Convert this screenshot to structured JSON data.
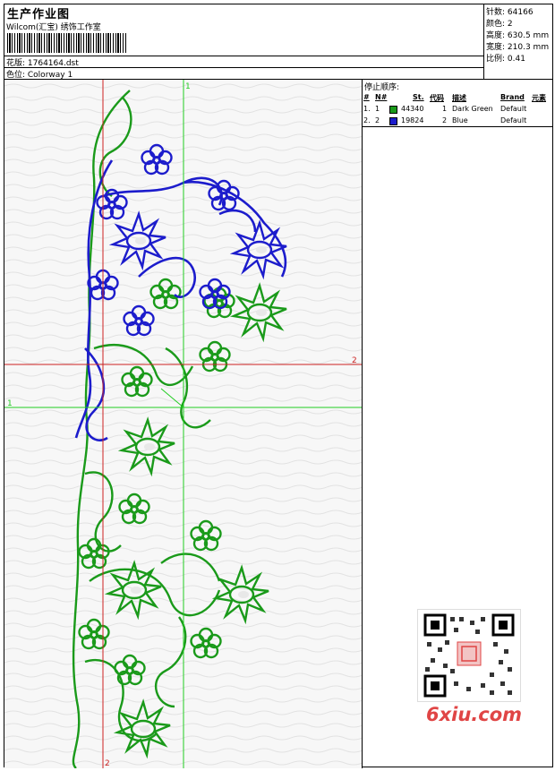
{
  "header": {
    "title": "生产作业图",
    "company": "Wilcom(汇宝) 绣饰工作室",
    "design_file": "花版: 1764164.dst",
    "colorway": "色位: Colorway 1"
  },
  "info": [
    {
      "label": "针数",
      "value": "64166"
    },
    {
      "label": "颜色",
      "value": "2"
    },
    {
      "label": "高度",
      "value": "630.5 mm"
    },
    {
      "label": "宽度",
      "value": "210.3 mm"
    },
    {
      "label": "比例",
      "value": "0.41"
    }
  ],
  "stop_sequence": {
    "title": "停止顺序:",
    "headers": {
      "index": "#",
      "needle": "N#",
      "stitches": "St.",
      "code": "代码",
      "desc": "描述",
      "brand": "Brand",
      "element": "元素"
    },
    "rows": [
      {
        "index": "1.",
        "needle": "1",
        "color": "#1a9a1a",
        "stitches": "44340",
        "code": "1",
        "desc": "Dark Green",
        "brand": "Default"
      },
      {
        "index": "2.",
        "needle": "2",
        "color": "#1c1ccc",
        "stitches": "19824",
        "code": "2",
        "desc": "Blue",
        "brand": "Default"
      }
    ]
  },
  "guides": {
    "label_1": "1",
    "label_2": "2"
  },
  "watermark": "6xiu.com",
  "colors": {
    "green": "#1a9a1a",
    "blue": "#1c1ccc",
    "guide_green": "#22cc22",
    "guide_red": "#cc2222"
  }
}
